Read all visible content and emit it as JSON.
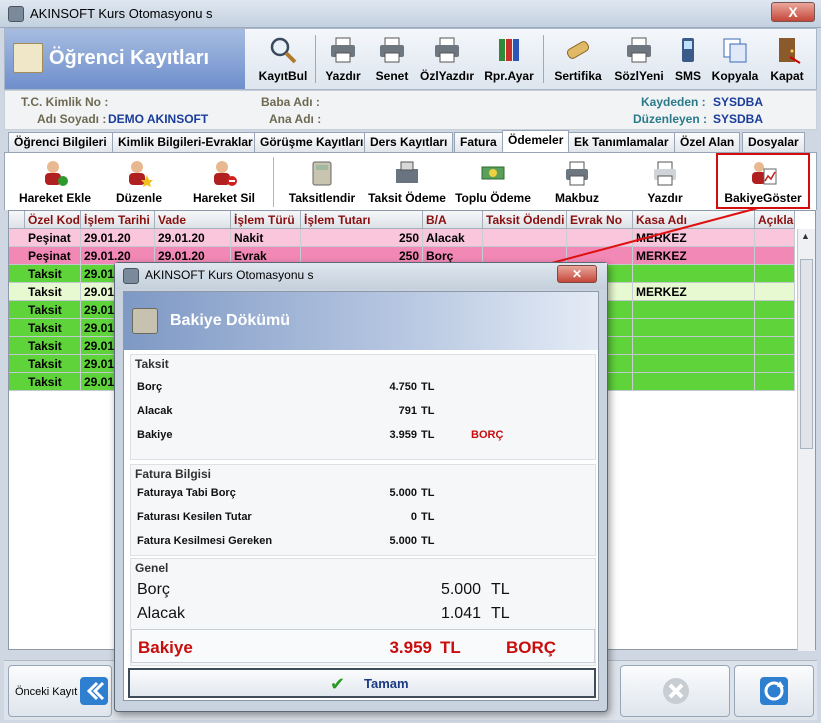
{
  "window": {
    "title": "AKINSOFT Kurs Otomasyonu s",
    "close_label": "X"
  },
  "header": {
    "title": "Öğrenci Kayıtları"
  },
  "toolbar": [
    {
      "label": "KayıtBul",
      "icon": "search-icon"
    },
    {
      "label": "Yazdır",
      "icon": "printer-icon"
    },
    {
      "label": "Senet",
      "icon": "printer-icon"
    },
    {
      "label": "ÖzlYazdır",
      "icon": "printer-icon"
    },
    {
      "label": "Rpr.Ayar",
      "icon": "books-icon"
    },
    {
      "label": "Sertifika",
      "icon": "scroll-icon"
    },
    {
      "label": "SözlYeni",
      "icon": "printer-icon"
    },
    {
      "label": "SMS",
      "icon": "phone-icon"
    },
    {
      "label": "Kopyala",
      "icon": "copy-icon"
    },
    {
      "label": "Kapat",
      "icon": "door-icon"
    }
  ],
  "info": {
    "tc_label": "T.C. Kimlik No :",
    "tc_value": "",
    "name_label": "Adı Soyadı :",
    "name_value": "DEMO AKINSOFT",
    "father_label": "Baba Adı :",
    "mother_label": "Ana Adı :",
    "creator_label": "Kaydeden :",
    "creator_value": "SYSDBA",
    "editor_label": "Düzenleyen :",
    "editor_value": "SYSDBA"
  },
  "tabs": [
    "Öğrenci Bilgileri",
    "Kimlik Bilgileri-Evraklar",
    "Görüşme Kayıtları",
    "Ders Kayıtları",
    "Fatura",
    "Ödemeler",
    "Ek Tanımlamalar",
    "Özel Alan",
    "Dosyalar"
  ],
  "actions": [
    {
      "label": "Hareket Ekle",
      "icon": "user-add-icon"
    },
    {
      "label": "Düzenle",
      "icon": "user-edit-icon"
    },
    {
      "label": "Hareket Sil",
      "icon": "user-delete-icon"
    },
    {
      "label": "Taksitlendir",
      "icon": "calculator-icon"
    },
    {
      "label": "Taksit Ödeme",
      "icon": "cash-register-icon"
    },
    {
      "label": "Toplu Ödeme",
      "icon": "money-icon"
    },
    {
      "label": "Makbuz",
      "icon": "printer-icon"
    },
    {
      "label": "Yazdır",
      "icon": "printer-icon"
    },
    {
      "label": "BakiyeGöster",
      "icon": "user-chart-icon"
    }
  ],
  "grid": {
    "columns": [
      "Özel Kod",
      "İşlem Tarihi",
      "Vade",
      "İşlem Türü",
      "İşlem Tutarı",
      "B/A",
      "Taksit Ödendi",
      "Evrak No",
      "Kasa Adı",
      "Açıkla"
    ],
    "rows": [
      [
        "Peşinat",
        "29.01.20",
        "29.01.20",
        "Nakit",
        "250",
        "Alacak",
        "",
        "",
        "MERKEZ",
        ""
      ],
      [
        "Peşinat",
        "29.01.20",
        "29.01.20",
        "Evrak",
        "250",
        "Borç",
        "",
        "",
        "MERKEZ",
        ""
      ],
      [
        "Taksit",
        "29.01",
        "",
        "",
        "",
        "",
        "",
        "",
        "",
        ""
      ],
      [
        "Taksit",
        "29.01",
        "",
        "",
        "",
        "",
        "",
        "",
        "MERKEZ",
        ""
      ],
      [
        "Taksit",
        "29.01",
        "",
        "",
        "",
        "",
        "",
        "",
        "",
        ""
      ],
      [
        "Taksit",
        "29.01",
        "",
        "",
        "",
        "",
        "",
        "",
        "",
        ""
      ],
      [
        "Taksit",
        "29.01",
        "",
        "",
        "",
        "",
        "",
        "",
        "",
        ""
      ],
      [
        "Taksit",
        "29.01",
        "",
        "",
        "",
        "",
        "",
        "",
        "",
        ""
      ],
      [
        "Taksit",
        "29.01",
        "",
        "",
        "",
        "",
        "",
        "",
        "",
        ""
      ]
    ]
  },
  "footer": {
    "prev_label": "Önceki Kayıt"
  },
  "dialog": {
    "title": "AKINSOFT Kurs Otomasyonu s",
    "heading": "Bakiye Dökümü",
    "taksit": {
      "group": "Taksit",
      "borc_label": "Borç",
      "borc": "4.750",
      "alacak_label": "Alacak",
      "alacak": "791",
      "bakiye_label": "Bakiye",
      "bakiye": "3.959",
      "bakiye_type": "BORÇ",
      "unit": "TL"
    },
    "fatura": {
      "group": "Fatura Bilgisi",
      "tabi_label": "Faturaya Tabi Borç",
      "tabi": "5.000",
      "kesilen_label": "Faturası Kesilen Tutar",
      "kesilen": "0",
      "gereken_label": "Fatura Kesilmesi Gereken",
      "gereken": "5.000",
      "unit": "TL"
    },
    "genel": {
      "group": "Genel",
      "borc_label": "Borç",
      "borc": "5.000",
      "alacak_label": "Alacak",
      "alacak": "1.041",
      "unit": "TL"
    },
    "total": {
      "label": "Bakiye",
      "value": "3.959",
      "unit": "TL",
      "type": "BORÇ"
    },
    "ok_label": "Tamam"
  }
}
